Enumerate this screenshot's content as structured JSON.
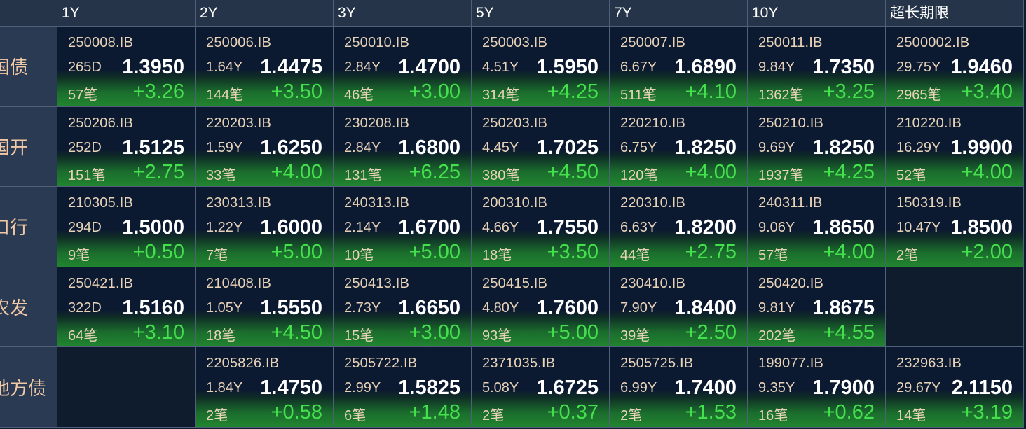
{
  "columns": [
    "1Y",
    "2Y",
    "3Y",
    "5Y",
    "7Y",
    "10Y",
    "超长期限"
  ],
  "rows": [
    {
      "label": "国债",
      "cells": [
        {
          "code": "250008.IB",
          "tenor": "265D",
          "yield": "1.3950",
          "count": "57笔",
          "change": "+3.26"
        },
        {
          "code": "250006.IB",
          "tenor": "1.64Y",
          "yield": "1.4475",
          "count": "144笔",
          "change": "+3.50"
        },
        {
          "code": "250010.IB",
          "tenor": "2.84Y",
          "yield": "1.4700",
          "count": "46笔",
          "change": "+3.00"
        },
        {
          "code": "250003.IB",
          "tenor": "4.51Y",
          "yield": "1.5950",
          "count": "314笔",
          "change": "+4.25"
        },
        {
          "code": "250007.IB",
          "tenor": "6.67Y",
          "yield": "1.6890",
          "count": "511笔",
          "change": "+4.10"
        },
        {
          "code": "250011.IB",
          "tenor": "9.84Y",
          "yield": "1.7350",
          "count": "1362笔",
          "change": "+3.25"
        },
        {
          "code": "2500002.IB",
          "tenor": "29.75Y",
          "yield": "1.9460",
          "count": "2965笔",
          "change": "+3.40"
        }
      ]
    },
    {
      "label": "国开",
      "cells": [
        {
          "code": "250206.IB",
          "tenor": "252D",
          "yield": "1.5125",
          "count": "151笔",
          "change": "+2.75"
        },
        {
          "code": "220203.IB",
          "tenor": "1.59Y",
          "yield": "1.6250",
          "count": "33笔",
          "change": "+4.00"
        },
        {
          "code": "230208.IB",
          "tenor": "2.84Y",
          "yield": "1.6800",
          "count": "131笔",
          "change": "+6.25"
        },
        {
          "code": "250203.IB",
          "tenor": "4.45Y",
          "yield": "1.7025",
          "count": "380笔",
          "change": "+4.50"
        },
        {
          "code": "220210.IB",
          "tenor": "6.75Y",
          "yield": "1.8250",
          "count": "120笔",
          "change": "+4.00"
        },
        {
          "code": "250210.IB",
          "tenor": "9.69Y",
          "yield": "1.8250",
          "count": "1937笔",
          "change": "+4.25"
        },
        {
          "code": "210220.IB",
          "tenor": "16.29Y",
          "yield": "1.9900",
          "count": "52笔",
          "change": "+4.00"
        }
      ]
    },
    {
      "label": "口行",
      "cells": [
        {
          "code": "210305.IB",
          "tenor": "294D",
          "yield": "1.5000",
          "count": "9笔",
          "change": "+0.50"
        },
        {
          "code": "230313.IB",
          "tenor": "1.22Y",
          "yield": "1.6000",
          "count": "7笔",
          "change": "+5.00"
        },
        {
          "code": "240313.IB",
          "tenor": "2.14Y",
          "yield": "1.6700",
          "count": "10笔",
          "change": "+5.00"
        },
        {
          "code": "200310.IB",
          "tenor": "4.66Y",
          "yield": "1.7550",
          "count": "18笔",
          "change": "+3.50"
        },
        {
          "code": "220310.IB",
          "tenor": "6.63Y",
          "yield": "1.8200",
          "count": "44笔",
          "change": "+2.75"
        },
        {
          "code": "240311.IB",
          "tenor": "9.06Y",
          "yield": "1.8650",
          "count": "57笔",
          "change": "+4.00"
        },
        {
          "code": "150319.IB",
          "tenor": "10.47Y",
          "yield": "1.8500",
          "count": "2笔",
          "change": "+2.00"
        }
      ]
    },
    {
      "label": "农发",
      "cells": [
        {
          "code": "250421.IB",
          "tenor": "322D",
          "yield": "1.5160",
          "count": "64笔",
          "change": "+3.10"
        },
        {
          "code": "210408.IB",
          "tenor": "1.05Y",
          "yield": "1.5550",
          "count": "18笔",
          "change": "+4.50"
        },
        {
          "code": "250413.IB",
          "tenor": "2.73Y",
          "yield": "1.6650",
          "count": "15笔",
          "change": "+3.00"
        },
        {
          "code": "250415.IB",
          "tenor": "4.80Y",
          "yield": "1.7600",
          "count": "93笔",
          "change": "+5.00"
        },
        {
          "code": "230410.IB",
          "tenor": "7.90Y",
          "yield": "1.8400",
          "count": "39笔",
          "change": "+2.50"
        },
        {
          "code": "250420.IB",
          "tenor": "9.81Y",
          "yield": "1.8675",
          "count": "202笔",
          "change": "+4.55"
        },
        null
      ]
    },
    {
      "label": "地方债",
      "cells": [
        null,
        {
          "code": "2205826.IB",
          "tenor": "1.84Y",
          "yield": "1.4750",
          "count": "2笔",
          "change": "+0.58"
        },
        {
          "code": "2505722.IB",
          "tenor": "2.99Y",
          "yield": "1.5825",
          "count": "6笔",
          "change": "+1.48"
        },
        {
          "code": "2371035.IB",
          "tenor": "5.08Y",
          "yield": "1.6725",
          "count": "2笔",
          "change": "+0.37"
        },
        {
          "code": "2505725.IB",
          "tenor": "6.99Y",
          "yield": "1.7400",
          "count": "2笔",
          "change": "+1.53"
        },
        {
          "code": "199077.IB",
          "tenor": "9.35Y",
          "yield": "1.7900",
          "count": "16笔",
          "change": "+0.62"
        },
        {
          "code": "232963.IB",
          "tenor": "29.67Y",
          "yield": "2.1150",
          "count": "14笔",
          "change": "+3.19"
        }
      ]
    }
  ]
}
